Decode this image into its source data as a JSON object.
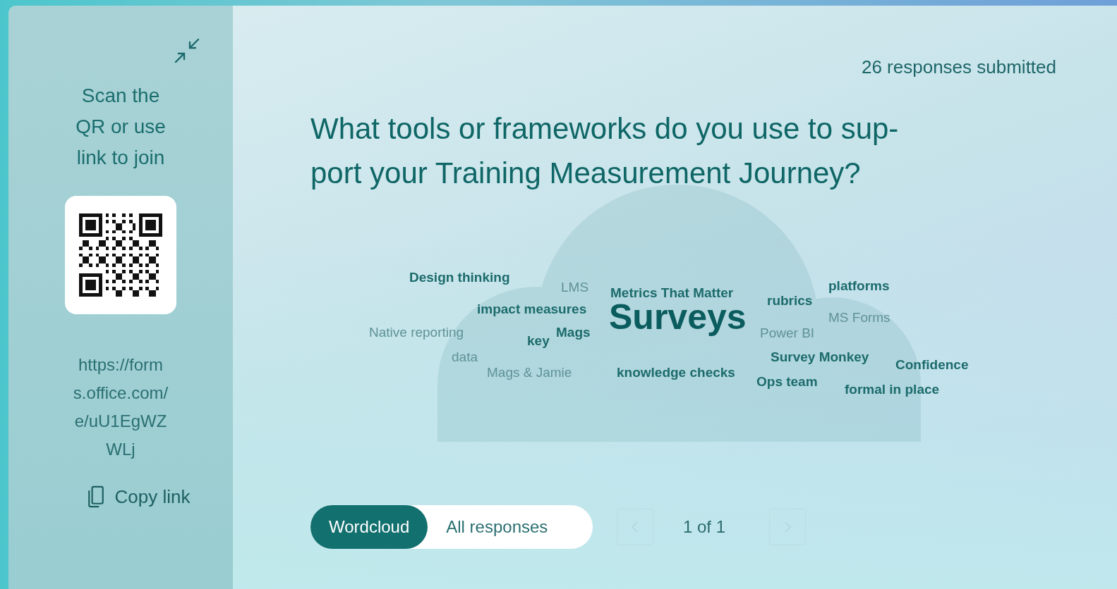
{
  "join_panel": {
    "instructions": "Scan the QR or use link to join",
    "link": "https://forms.office.com/e/uU1EgWZWLj",
    "copy_button": "Copy link"
  },
  "response_count": "26 responses submitted",
  "question_lines": [
    "What tools or frameworks do you use to sup-",
    "port your Training Measurement Journey?"
  ],
  "wordcloud": [
    {
      "text": "Design thinking",
      "kind": "normal",
      "faded": false
    },
    {
      "text": "LMS",
      "kind": "normal",
      "faded": true
    },
    {
      "text": "platforms",
      "kind": "normal",
      "faded": false
    },
    {
      "text": "Metrics That Matter",
      "kind": "normal",
      "faded": false
    },
    {
      "text": "rubrics",
      "kind": "normal",
      "faded": false
    },
    {
      "text": "impact measures",
      "kind": "normal",
      "faded": false
    },
    {
      "text": "Surveys",
      "kind": "large",
      "faded": false
    },
    {
      "text": "MS Forms",
      "kind": "normal",
      "faded": true
    },
    {
      "text": "Native reporting",
      "kind": "normal",
      "faded": true
    },
    {
      "text": "Mags",
      "kind": "normal",
      "faded": false
    },
    {
      "text": "Power BI",
      "kind": "normal",
      "faded": true
    },
    {
      "text": "key",
      "kind": "normal",
      "faded": false
    },
    {
      "text": "data",
      "kind": "normal",
      "faded": true
    },
    {
      "text": "Survey Monkey",
      "kind": "normal",
      "faded": false
    },
    {
      "text": "Confidence",
      "kind": "normal",
      "faded": false
    },
    {
      "text": "Mags & Jamie",
      "kind": "normal",
      "faded": true
    },
    {
      "text": "knowledge checks",
      "kind": "normal",
      "faded": false
    },
    {
      "text": "Ops team",
      "kind": "normal",
      "faded": false
    },
    {
      "text": "formal in place",
      "kind": "normal",
      "faded": false
    }
  ],
  "view_tabs": [
    {
      "label": "Wordcloud",
      "selected": true
    },
    {
      "label": "All responses",
      "selected": false
    }
  ],
  "pager": {
    "text": "1 of 1",
    "previous_disabled": true,
    "next_disabled": true
  }
}
